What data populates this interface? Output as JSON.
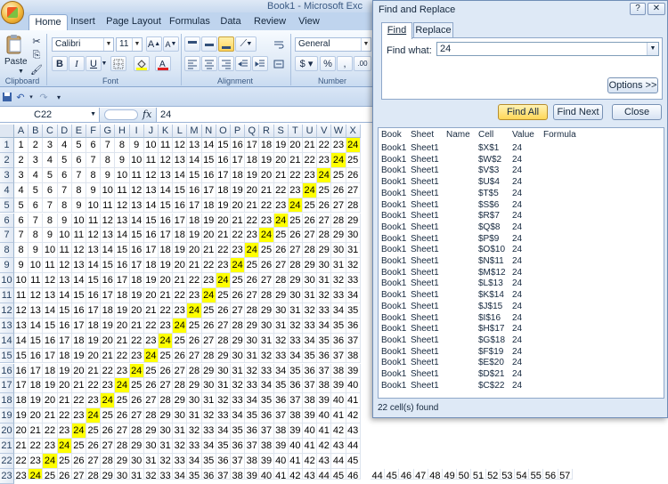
{
  "excel": {
    "title": "Book1 - Microsoft Exc",
    "tabs": [
      "Home",
      "Insert",
      "Page Layout",
      "Formulas",
      "Data",
      "Review",
      "View"
    ],
    "ribbon": {
      "paste_label": "Paste",
      "font_name": "Calibri",
      "font_size": "11",
      "number_format": "General",
      "groups": [
        "Clipboard",
        "Font",
        "Alignment",
        "Number"
      ]
    },
    "name_box": "C22",
    "fx_label": "fx",
    "formula_value": "24",
    "columns": [
      "A",
      "B",
      "C",
      "D",
      "E",
      "F",
      "G",
      "H",
      "I",
      "J",
      "K",
      "L",
      "M",
      "N",
      "O",
      "P",
      "Q",
      "R",
      "S",
      "T",
      "U",
      "V",
      "W",
      "X"
    ],
    "rows": [
      "1",
      "2",
      "3",
      "4",
      "5",
      "6",
      "7",
      "8",
      "9",
      "10",
      "11",
      "12",
      "13",
      "14",
      "15",
      "16",
      "17",
      "18",
      "19",
      "20",
      "21",
      "22",
      "23"
    ],
    "visible_row23_values": [
      "44",
      "45",
      "46",
      "47",
      "48",
      "49",
      "50",
      "51",
      "52",
      "53",
      "54",
      "55",
      "56",
      "57"
    ],
    "highlight_value": "24",
    "highlight_color": "#ffff00"
  },
  "dialog": {
    "title": "Find and Replace",
    "help_glyph": "?",
    "close_glyph": "✕",
    "tabs": [
      "Find",
      "Replace"
    ],
    "find_what_label": "Find what:",
    "find_what_value": "24",
    "options_label": "Options >>",
    "find_all_label": "Find All",
    "find_next_label": "Find Next",
    "close_label": "Close",
    "columns": [
      "Book",
      "Sheet",
      "Name",
      "Cell",
      "Value",
      "Formula"
    ],
    "results": [
      [
        "Book1",
        "Sheet1",
        "",
        "$X$1",
        "24"
      ],
      [
        "Book1",
        "Sheet1",
        "",
        "$W$2",
        "24"
      ],
      [
        "Book1",
        "Sheet1",
        "",
        "$V$3",
        "24"
      ],
      [
        "Book1",
        "Sheet1",
        "",
        "$U$4",
        "24"
      ],
      [
        "Book1",
        "Sheet1",
        "",
        "$T$5",
        "24"
      ],
      [
        "Book1",
        "Sheet1",
        "",
        "$S$6",
        "24"
      ],
      [
        "Book1",
        "Sheet1",
        "",
        "$R$7",
        "24"
      ],
      [
        "Book1",
        "Sheet1",
        "",
        "$Q$8",
        "24"
      ],
      [
        "Book1",
        "Sheet1",
        "",
        "$P$9",
        "24"
      ],
      [
        "Book1",
        "Sheet1",
        "",
        "$O$10",
        "24"
      ],
      [
        "Book1",
        "Sheet1",
        "",
        "$N$11",
        "24"
      ],
      [
        "Book1",
        "Sheet1",
        "",
        "$M$12",
        "24"
      ],
      [
        "Book1",
        "Sheet1",
        "",
        "$L$13",
        "24"
      ],
      [
        "Book1",
        "Sheet1",
        "",
        "$K$14",
        "24"
      ],
      [
        "Book1",
        "Sheet1",
        "",
        "$J$15",
        "24"
      ],
      [
        "Book1",
        "Sheet1",
        "",
        "$I$16",
        "24"
      ],
      [
        "Book1",
        "Sheet1",
        "",
        "$H$17",
        "24"
      ],
      [
        "Book1",
        "Sheet1",
        "",
        "$G$18",
        "24"
      ],
      [
        "Book1",
        "Sheet1",
        "",
        "$F$19",
        "24"
      ],
      [
        "Book1",
        "Sheet1",
        "",
        "$E$20",
        "24"
      ],
      [
        "Book1",
        "Sheet1",
        "",
        "$D$21",
        "24"
      ],
      [
        "Book1",
        "Sheet1",
        "",
        "$C$22",
        "24"
      ]
    ],
    "status": "22 cell(s) found"
  }
}
